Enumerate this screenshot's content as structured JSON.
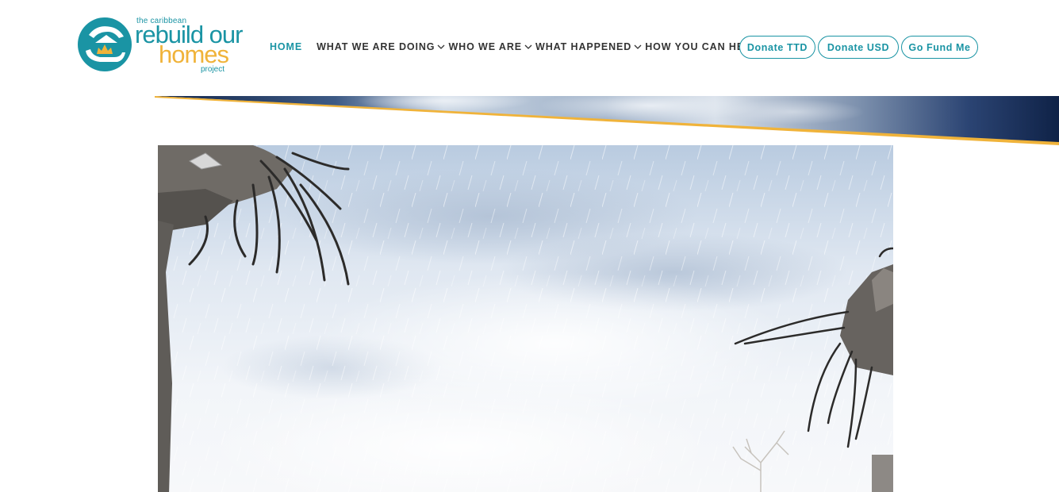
{
  "logo": {
    "line1": "the caribbean",
    "line2": "rebuild our",
    "line3": "homes",
    "line4": "project"
  },
  "nav": {
    "items": [
      {
        "label": "HOME",
        "active": true,
        "has_dropdown": false
      },
      {
        "label": "WHAT WE ARE DOING",
        "active": false,
        "has_dropdown": true
      },
      {
        "label": "WHO WE ARE",
        "active": false,
        "has_dropdown": true
      },
      {
        "label": "WHAT HAPPENED",
        "active": false,
        "has_dropdown": true
      },
      {
        "label": "HOW YOU CAN HELP",
        "active": false,
        "has_dropdown": true
      }
    ],
    "buttons": {
      "donate_ttd": "Donate TTD",
      "donate_usd": "Donate USD",
      "go_fund_me": "Go Fund Me"
    }
  },
  "colors": {
    "brand_teal": "#1a94a4",
    "brand_gold": "#f0b33a",
    "nav_text": "#333333",
    "banner_navy": "#16294f"
  },
  "icons": {
    "logo_mark": "hands-house-sun-icon",
    "dropdown": "chevron-down-icon"
  },
  "hero": {
    "subject": "storm-damaged building debris with exposed rebar under rainy sky"
  }
}
